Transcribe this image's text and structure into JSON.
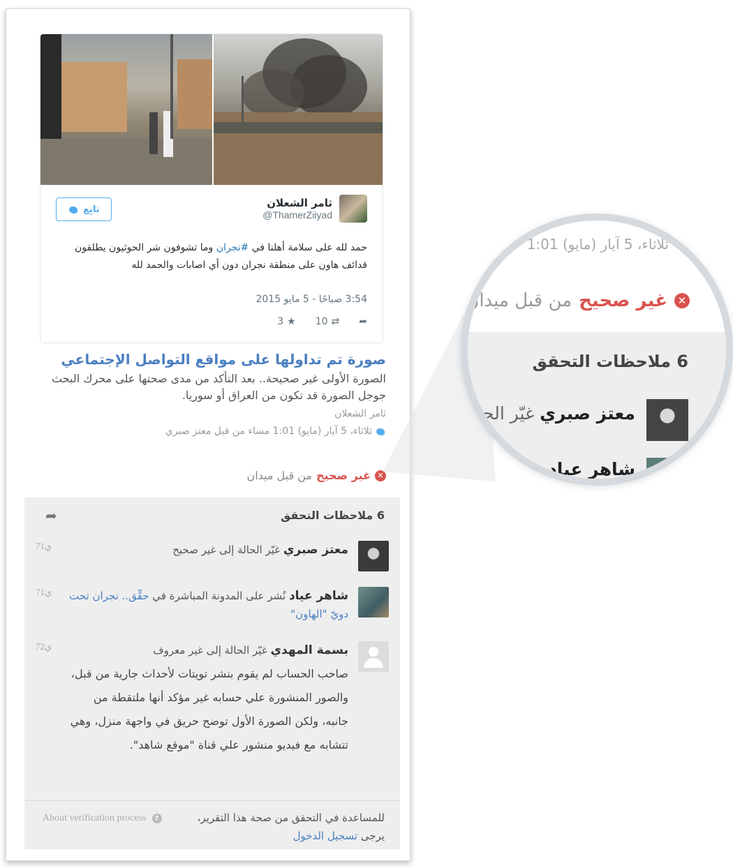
{
  "tweet": {
    "author_name": "ثامر الشعلان",
    "author_handle": "@ThamerZiiyad",
    "follow_label": "تابِع",
    "text_before": "حمد لله  على سلامة أهلنا في ",
    "hashtag": "#نجران",
    "text_after": " وما تشوفون شر الحوثيون يطلقون قدائف هاون على منطقة نجران دون أي اصابات والحمد لله",
    "timestamp": "3:54 صباحًا - 5 مايو 2015",
    "retweets": "10",
    "favorites": "3",
    "reply_icon": "reply-icon",
    "retweet_icon": "retweet-icon",
    "favorite_icon": "star-icon"
  },
  "item": {
    "title": "صورة تم تداولها على مواقع التواصل الإجتماعي",
    "description": "الصورة الأولى غير صحيحة.. بعد التأكد من مدى صحتها على محرك البحث جوجل الصورة قد تكون من العراق أو سوريا.",
    "author": "ثامر الشعلان",
    "meta": "ثلاثاء، 5 آيار (مايو) 1:01 مساء من قبل معتز صبري"
  },
  "status": {
    "label": "غير صحيح",
    "by": "من قبل ميدان",
    "color": "#d9534f"
  },
  "notes": {
    "heading": "6 ملاحظات التحقق",
    "items": [
      {
        "name": "معتز صبري",
        "action": "غيّر الحالة إلى غير صحيح",
        "time": "71ي"
      },
      {
        "name": "شاهر عياد",
        "action": "نُشر على المدونة المباشرة في ",
        "link": "حقِّق.. نجران تحت دويّ \"الهاون\"",
        "time": "71ي"
      },
      {
        "name": "بسمة المهدي",
        "action": "غيّر الحالة إلى غير معروف",
        "comment": "صاحب الحساب لم يقوم بنشر تويتات لأحداث جارية من قبل، والصور المنشورة علي حسابه غير مؤكد أنها ملتقطة من جانبه، ولكن الصورة الأول توضح حريق في واجهة منزل، وهي تتشابه مع فيديو منشور علي قناة \"موقع شاهد\".",
        "time": "72ي"
      }
    ],
    "login_text": "للمساعدة في التحقق من صحة هذا التقرير، يرجى ",
    "login_link": "تسجيل الدخول",
    "about": "About verification process"
  },
  "magnifier": {
    "meta": "ثلاثاء، 5 آيار (مايو) 1:01",
    "status_label": "غير صحيح",
    "status_by": "من قبل ميدان",
    "heading": "6 ملاحظات التحقق",
    "note_name": "معتز صبري",
    "note_action": "غيّر الحالة",
    "note2_name": "شاهر عياد"
  }
}
